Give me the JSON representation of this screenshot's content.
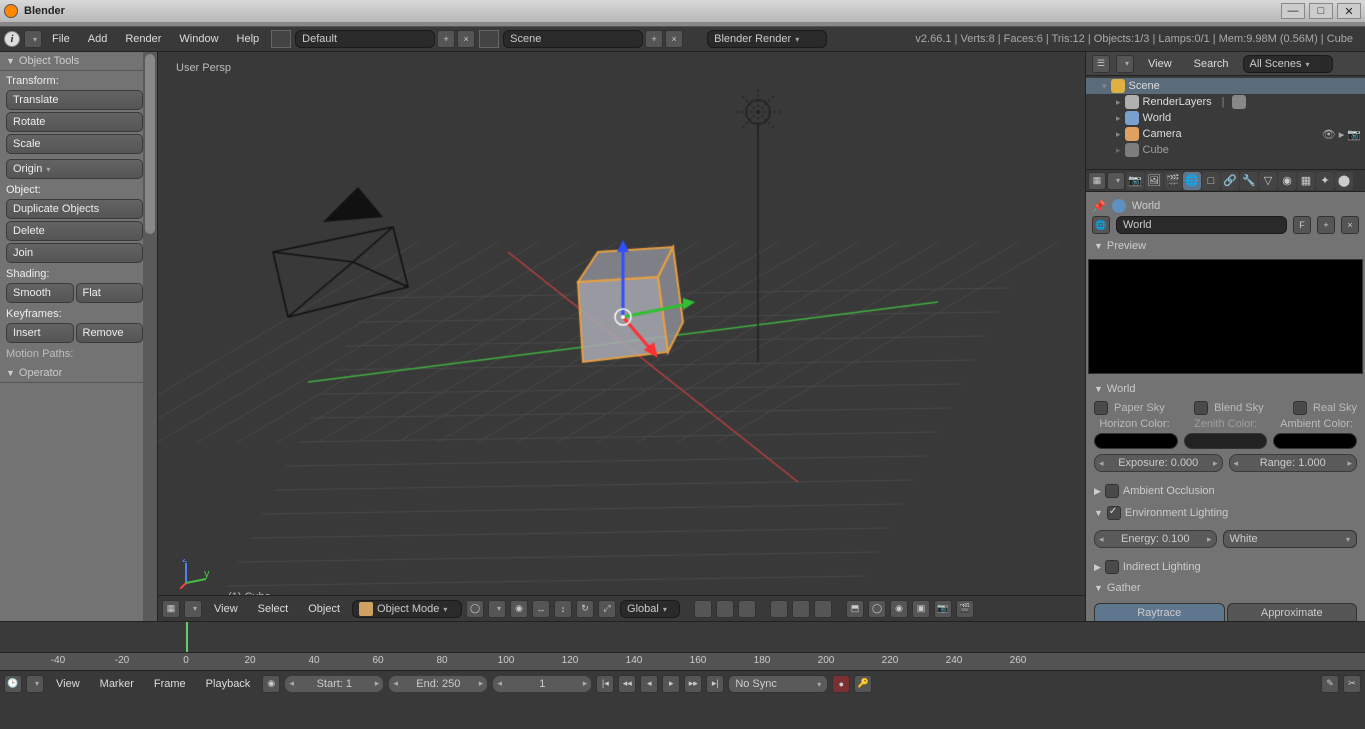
{
  "titlebar": {
    "title": "Blender"
  },
  "topmenu": {
    "items": [
      "File",
      "Add",
      "Render",
      "Window",
      "Help"
    ],
    "layout": "Default",
    "scene": "Scene",
    "renderer": "Blender Render",
    "stats": "v2.66.1 | Verts:8 | Faces:6 | Tris:12 | Objects:1/3 | Lamps:0/1 | Mem:9.98M (0.56M) | Cube"
  },
  "toolpanel": {
    "title": "Object Tools",
    "transform_label": "Transform:",
    "translate": "Translate",
    "rotate": "Rotate",
    "scale": "Scale",
    "origin": "Origin",
    "object_label": "Object:",
    "duplicate": "Duplicate Objects",
    "delete": "Delete",
    "join": "Join",
    "shading_label": "Shading:",
    "smooth": "Smooth",
    "flat": "Flat",
    "keyframes_label": "Keyframes:",
    "insert": "Insert",
    "remove": "Remove",
    "motion": "Motion Paths:",
    "operator": "Operator"
  },
  "viewport": {
    "persp": "User Persp",
    "obj": "(1) Cube"
  },
  "header3d": {
    "menus": [
      "View",
      "Select",
      "Object"
    ],
    "mode": "Object Mode",
    "orient": "Global"
  },
  "outliner": {
    "hdr": {
      "view": "View",
      "search": "Search",
      "filter": "All Scenes"
    },
    "items": [
      {
        "label": "Scene",
        "indent": 0,
        "sel": true,
        "ico": "#e0b040"
      },
      {
        "label": "RenderLayers",
        "indent": 1,
        "ico": "#b0b0b0",
        "extra": true
      },
      {
        "label": "World",
        "indent": 1,
        "ico": "#7aa0d0"
      },
      {
        "label": "Camera",
        "indent": 1,
        "ico": "#e0a060",
        "icons": true
      },
      {
        "label": "Cube",
        "indent": 1,
        "ico": "#aaa",
        "dim": true
      }
    ]
  },
  "props": {
    "breadcrumb": "World",
    "world_name": "World",
    "preview": "Preview",
    "world": "World",
    "paper_sky": "Paper Sky",
    "blend_sky": "Blend Sky",
    "real_sky": "Real Sky",
    "horizon": "Horizon Color:",
    "zenith": "Zenith Color:",
    "ambient": "Ambient Color:",
    "exposure": "Exposure: 0.000",
    "range": "Range: 1.000",
    "ao": "Ambient Occlusion",
    "env": "Environment Lighting",
    "energy": "Energy: 0.100",
    "envcolor": "White",
    "indirect": "Indirect Lighting",
    "gather": "Gather",
    "raytrace": "Raytrace",
    "approx": "Approximate"
  },
  "timeline": {
    "ticks": [
      "-40",
      "-20",
      "0",
      "20",
      "40",
      "60",
      "80",
      "100",
      "120",
      "140",
      "160",
      "180",
      "200",
      "220",
      "240",
      "260"
    ],
    "menus": [
      "View",
      "Marker",
      "Frame",
      "Playback"
    ],
    "start": "Start: 1",
    "end": "End: 250",
    "current": "1",
    "sync": "No Sync"
  }
}
